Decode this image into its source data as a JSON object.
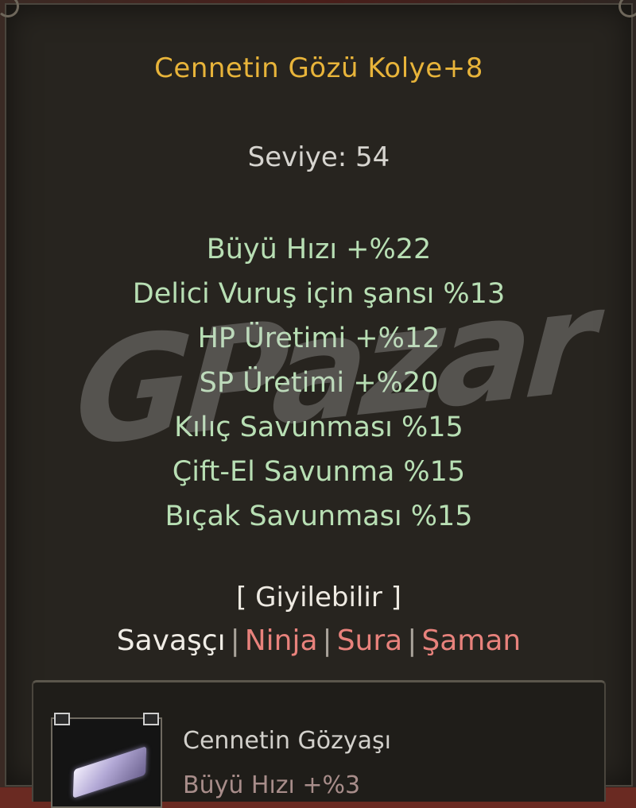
{
  "tooltip": {
    "item_name": "Cennetin Gözü Kolye+8",
    "level": "Seviye: 54",
    "stats": [
      "Büyü Hızı +%22",
      "Delici Vuruş için şansı %13",
      "HP Üretimi +%12",
      "SP Üretimi +%20",
      "Kılıç Savunması %15",
      "Çift-El Savunma %15",
      "Bıçak Savunması %15"
    ],
    "wearable_label": "[ Giyilebilir ]",
    "classes": [
      {
        "name": "Savaşçı",
        "allowed": true
      },
      {
        "name": "Ninja",
        "allowed": false
      },
      {
        "name": "Sura",
        "allowed": false
      },
      {
        "name": "Şaman",
        "allowed": false
      }
    ],
    "separator": "|",
    "colors": {
      "title": "#e8b43a",
      "stat": "#b8dfb4",
      "allowed_class": "#f0ede6",
      "disallowed_class": "#e8827c"
    }
  },
  "watermark": "GPazar",
  "attached_item": {
    "name": "Cennetin Gözyaşı",
    "partial_stat": "Büyü Hızı +%3",
    "icon": "gem-icon"
  }
}
